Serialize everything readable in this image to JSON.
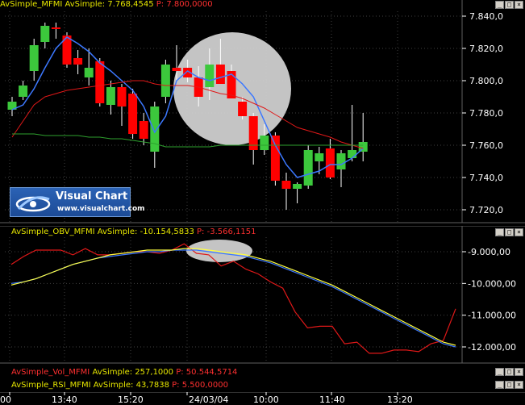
{
  "price_pane": {
    "indicator": "AvSimple_MFMI",
    "indicator_label": "AvSimple: 7.768,4545",
    "p_label": "P: 7.800,0000",
    "axis_labels": [
      "7.840,0",
      "7.820,0",
      "7.800,0",
      "7.780,0",
      "7.760,0",
      "7.740,0",
      "7.720,0"
    ],
    "axis_values": [
      7840,
      7820,
      7800,
      7780,
      7760,
      7740,
      7720
    ]
  },
  "osc_pane": {
    "indicator": "AvSimple_OBV_MFMI",
    "indicator_label": "AvSimple: -10.154,5833",
    "p_label": "P: -3.566,1151",
    "axis_labels": [
      "-9.000,00",
      "-10.000,00",
      "-11.000,00",
      "-12.000,00"
    ],
    "axis_values": [
      -9000,
      -10000,
      -11000,
      -12000
    ]
  },
  "vol_pane": {
    "indicator": "AvSimple_Vol_MFMI",
    "indicator_label": "AvSimple: 257,1000",
    "p_label": "P: 50.544,5714"
  },
  "rsi_pane": {
    "indicator": "AvSimple_RSI_MFMI",
    "indicator_label": "AvSimple: 43,7838",
    "p_label": "P: 5.500,0000"
  },
  "time_axis": {
    "labels": [
      "00",
      "13:40",
      "15:20",
      "24/03/04",
      "10:00",
      "11:40",
      "13:20"
    ]
  },
  "logo": {
    "title": "Visual Chart",
    "url": "www.visualchart.com"
  },
  "window_buttons": [
    "_",
    "□",
    "×"
  ],
  "colors": {
    "up_candle": "#3cc83c",
    "down_candle": "#ff0000",
    "ma_blue": "#3c78ff",
    "ma_red": "#e01818",
    "ma_green": "#2ea02e",
    "yellow_line": "#ffff40",
    "highlight": "#cfcfcf",
    "grid": "#404040"
  },
  "chart_data": [
    {
      "type": "candlestick",
      "title": "AvSimple_MFMI",
      "ylim": [
        7715,
        7845
      ],
      "candles": [
        {
          "o": 7782,
          "h": 7790,
          "l": 7778,
          "c": 7787
        },
        {
          "o": 7790,
          "h": 7800,
          "l": 7788,
          "c": 7797
        },
        {
          "o": 7806,
          "h": 7826,
          "l": 7800,
          "c": 7822
        },
        {
          "o": 7824,
          "h": 7836,
          "l": 7820,
          "c": 7834
        },
        {
          "o": 7833,
          "h": 7836,
          "l": 7826,
          "c": 7832
        },
        {
          "o": 7828,
          "h": 7830,
          "l": 7808,
          "c": 7810
        },
        {
          "o": 7814,
          "h": 7819,
          "l": 7804,
          "c": 7810
        },
        {
          "o": 7802,
          "h": 7820,
          "l": 7797,
          "c": 7808
        },
        {
          "o": 7812,
          "h": 7814,
          "l": 7784,
          "c": 7786
        },
        {
          "o": 7785,
          "h": 7800,
          "l": 7779,
          "c": 7796
        },
        {
          "o": 7796,
          "h": 7798,
          "l": 7772,
          "c": 7784
        },
        {
          "o": 7792,
          "h": 7795,
          "l": 7764,
          "c": 7767
        },
        {
          "o": 7775,
          "h": 7780,
          "l": 7760,
          "c": 7764
        },
        {
          "o": 7756,
          "h": 7787,
          "l": 7746,
          "c": 7784
        },
        {
          "o": 7790,
          "h": 7813,
          "l": 7786,
          "c": 7810
        },
        {
          "o": 7808,
          "h": 7822,
          "l": 7799,
          "c": 7806
        },
        {
          "o": 7808,
          "h": 7813,
          "l": 7799,
          "c": 7802
        },
        {
          "o": 7802,
          "h": 7809,
          "l": 7784,
          "c": 7790
        },
        {
          "o": 7796,
          "h": 7820,
          "l": 7788,
          "c": 7810
        },
        {
          "o": 7810,
          "h": 7826,
          "l": 7801,
          "c": 7798
        },
        {
          "o": 7806,
          "h": 7810,
          "l": 7790,
          "c": 7789
        },
        {
          "o": 7787,
          "h": 7790,
          "l": 7776,
          "c": 7778
        },
        {
          "o": 7778,
          "h": 7780,
          "l": 7748,
          "c": 7757
        },
        {
          "o": 7757,
          "h": 7773,
          "l": 7754,
          "c": 7766
        },
        {
          "o": 7766,
          "h": 7768,
          "l": 7735,
          "c": 7738
        },
        {
          "o": 7738,
          "h": 7743,
          "l": 7720,
          "c": 7733
        },
        {
          "o": 7733,
          "h": 7737,
          "l": 7724,
          "c": 7736
        },
        {
          "o": 7735,
          "h": 7760,
          "l": 7733,
          "c": 7757
        },
        {
          "o": 7750,
          "h": 7759,
          "l": 7742,
          "c": 7755
        },
        {
          "o": 7758,
          "h": 7764,
          "l": 7739,
          "c": 7740
        },
        {
          "o": 7745,
          "h": 7757,
          "l": 7734,
          "c": 7755
        },
        {
          "o": 7752,
          "h": 7785,
          "l": 7750,
          "c": 7757
        },
        {
          "o": 7756,
          "h": 7780,
          "l": 7750,
          "c": 7762
        }
      ],
      "series": [
        {
          "name": "AvSimple_MFMI",
          "values": [
            7782,
            7785,
            7795,
            7808,
            7820,
            7827,
            7823,
            7818,
            7811,
            7806,
            7800,
            7794,
            7784,
            7768,
            7778,
            7800,
            7806,
            7802,
            7800,
            7802,
            7804,
            7798,
            7790,
            7775,
            7760,
            7748,
            7740,
            7742,
            7744,
            7748,
            7748,
            7752,
            7758
          ]
        },
        {
          "name": "MA red",
          "values": [
            7765,
            7775,
            7785,
            7790,
            7792,
            7794,
            7795,
            7796,
            7797,
            7798,
            7799,
            7800,
            7800,
            7798,
            7797,
            7797,
            7797,
            7796,
            7794,
            7792,
            7791,
            7789,
            7786,
            7783,
            7779,
            7775,
            7771,
            7769,
            7767,
            7765,
            7762,
            7760,
            7758
          ]
        },
        {
          "name": "MA green",
          "values": [
            7767,
            7767,
            7767,
            7766,
            7766,
            7766,
            7766,
            7765,
            7765,
            7764,
            7764,
            7763,
            7762,
            7761,
            7759,
            7759,
            7759,
            7759,
            7759,
            7760,
            7760,
            7760,
            7760,
            7760,
            7760,
            7760,
            7760,
            7760,
            7760,
            7760,
            7760,
            7760,
            7760
          ]
        }
      ]
    },
    {
      "type": "line",
      "title": "AvSimple_OBV_MFMI",
      "ylim": [
        -12400,
        -8500
      ],
      "series": [
        {
          "name": "OBV",
          "values": [
            -9400,
            -9150,
            -8950,
            -8950,
            -8950,
            -9100,
            -8900,
            -9100,
            -9100,
            -9050,
            -9000,
            -9000,
            -9050,
            -8950,
            -8750,
            -9050,
            -9100,
            -9450,
            -9300,
            -9550,
            -9700,
            -9950,
            -10150,
            -10900,
            -11400,
            -11350,
            -11350,
            -11900,
            -11850,
            -12200,
            -12200,
            -12100,
            -12100,
            -12150,
            -11900,
            -11800,
            -10800
          ]
        },
        {
          "name": "AvSimple_OBV_MFMI",
          "values": [
            -10000,
            -9950,
            -9850,
            -9700,
            -9550,
            -9400,
            -9300,
            -9200,
            -9150,
            -9100,
            -9050,
            -9000,
            -9000,
            -8950,
            -8950,
            -8950,
            -9000,
            -9050,
            -9100,
            -9150,
            -9250,
            -9350,
            -9500,
            -9650,
            -9800,
            -9950,
            -10100,
            -10300,
            -10500,
            -10700,
            -10900,
            -11100,
            -11300,
            -11500,
            -11700,
            -11900,
            -12000
          ]
        },
        {
          "name": "AvSimple yellow",
          "values": [
            -10050,
            -9950,
            -9850,
            -9700,
            -9550,
            -9400,
            -9300,
            -9200,
            -9100,
            -9050,
            -9000,
            -8950,
            -8950,
            -8950,
            -8900,
            -8900,
            -8950,
            -9000,
            -9050,
            -9100,
            -9200,
            -9300,
            -9450,
            -9600,
            -9750,
            -9900,
            -10050,
            -10250,
            -10450,
            -10650,
            -10850,
            -11050,
            -11250,
            -11450,
            -11650,
            -11850,
            -11950
          ]
        }
      ]
    }
  ]
}
